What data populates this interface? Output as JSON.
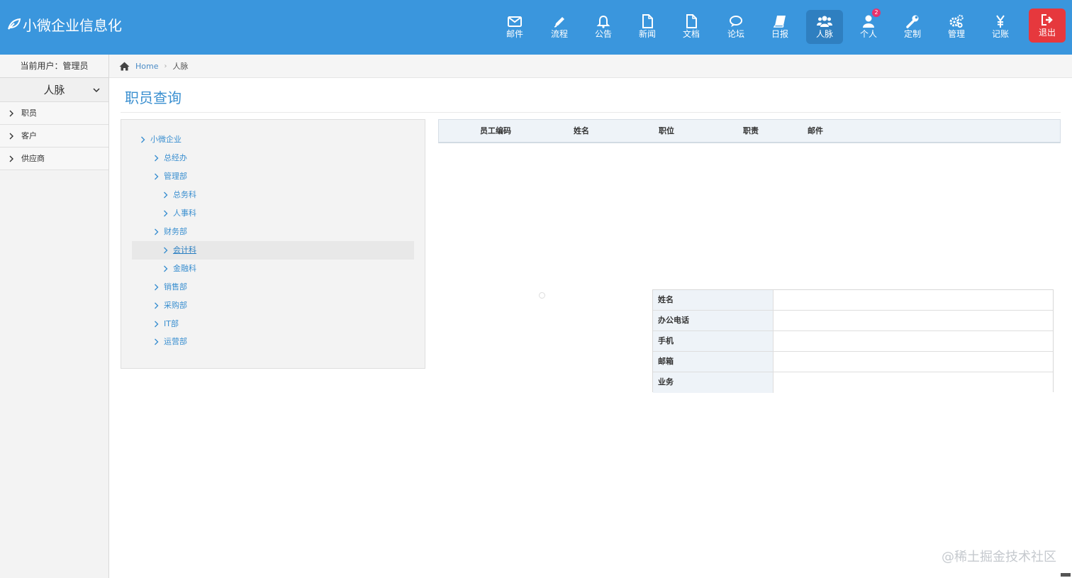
{
  "brand": {
    "title": "小微企业信息化",
    "logo_icon": "leaf-icon"
  },
  "nav": [
    {
      "key": "mail",
      "label": "邮件",
      "icon": "envelope-icon"
    },
    {
      "key": "flow",
      "label": "流程",
      "icon": "pencil-icon"
    },
    {
      "key": "notice",
      "label": "公告",
      "icon": "bell-icon"
    },
    {
      "key": "news",
      "label": "新闻",
      "icon": "file-icon"
    },
    {
      "key": "docs",
      "label": "文档",
      "icon": "file-icon"
    },
    {
      "key": "forum",
      "label": "论坛",
      "icon": "comments-icon"
    },
    {
      "key": "daily",
      "label": "日报",
      "icon": "book-icon"
    },
    {
      "key": "contacts",
      "label": "人脉",
      "icon": "users-icon",
      "active": true
    },
    {
      "key": "personal",
      "label": "个人",
      "icon": "user-icon",
      "badge": "2"
    },
    {
      "key": "custom",
      "label": "定制",
      "icon": "wrench-icon"
    },
    {
      "key": "manage",
      "label": "管理",
      "icon": "gears-icon"
    },
    {
      "key": "account",
      "label": "记账",
      "icon": "yen-icon"
    },
    {
      "key": "logout",
      "label": "退出",
      "icon": "sign-out-icon"
    }
  ],
  "sidebar": {
    "current_user": "当前用户：管理员",
    "section": "人脉",
    "items": [
      {
        "label": "职员"
      },
      {
        "label": "客户"
      },
      {
        "label": "供应商"
      }
    ]
  },
  "breadcrumb": {
    "home": "Home",
    "current": "人脉"
  },
  "page_title": "职员查询",
  "tree": [
    {
      "label": "小微企业",
      "level": 0
    },
    {
      "label": "总经办",
      "level": 1
    },
    {
      "label": "管理部",
      "level": 1
    },
    {
      "label": "总务科",
      "level": 2
    },
    {
      "label": "人事科",
      "level": 2
    },
    {
      "label": "财务部",
      "level": 1
    },
    {
      "label": "会计科",
      "level": 2,
      "selected": true
    },
    {
      "label": "金融科",
      "level": 2
    },
    {
      "label": "销售部",
      "level": 1
    },
    {
      "label": "采购部",
      "level": 1
    },
    {
      "label": "IT部",
      "level": 1
    },
    {
      "label": "运营部",
      "level": 1
    }
  ],
  "employee_table": {
    "columns": [
      "员工编码",
      "姓名",
      "职位",
      "职责",
      "邮件"
    ],
    "rows": []
  },
  "detail": {
    "fields": [
      {
        "label": "姓名",
        "value": ""
      },
      {
        "label": "办公电话",
        "value": ""
      },
      {
        "label": "手机",
        "value": ""
      },
      {
        "label": "邮箱",
        "value": ""
      },
      {
        "label": "业务",
        "value": ""
      }
    ]
  },
  "watermark": "@稀土掘金技术社区",
  "colors": {
    "topbar": "#3a96dd",
    "active_nav": "#2f7fc0",
    "logout": "#e6383d",
    "link": "#3a8fd0",
    "badge": "#e8336b"
  }
}
